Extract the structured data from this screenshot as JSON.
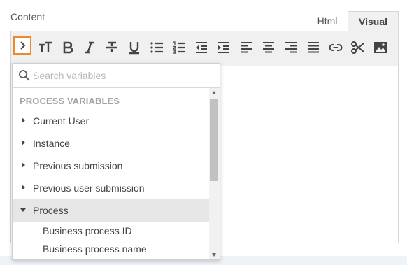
{
  "field": {
    "label": "Content"
  },
  "tabs": [
    {
      "label": "Html",
      "active": false
    },
    {
      "label": "Visual",
      "active": true
    }
  ],
  "toolbar": {
    "buttons": [
      "insert-variable",
      "font-size",
      "bold",
      "italic",
      "strikethrough",
      "underline",
      "bulleted-list",
      "numbered-list",
      "outdent",
      "indent",
      "align-left",
      "align-center",
      "align-right",
      "justify",
      "link",
      "cut",
      "image"
    ],
    "highlight_color": "#ed8b2a",
    "icon_color": "#444444"
  },
  "variables_dropdown": {
    "search": {
      "placeholder": "Search variables",
      "value": ""
    },
    "section_header": "PROCESS VARIABLES",
    "items": [
      {
        "label": "Current User",
        "expanded": false
      },
      {
        "label": "Instance",
        "expanded": false
      },
      {
        "label": "Previous submission",
        "expanded": false
      },
      {
        "label": "Previous user submission",
        "expanded": false
      },
      {
        "label": "Process",
        "expanded": true
      }
    ],
    "process_children": [
      {
        "label": "Business process ID"
      },
      {
        "label": "Business process name"
      }
    ]
  }
}
